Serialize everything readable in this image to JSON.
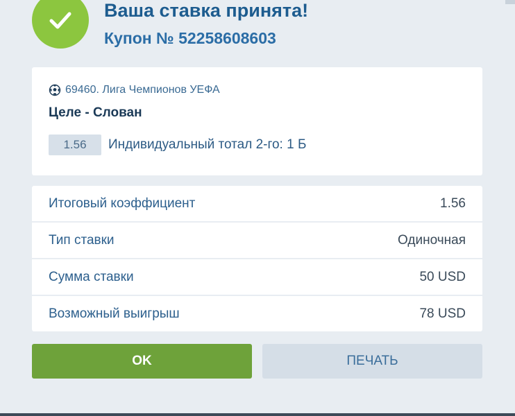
{
  "header": {
    "title": "Ваша ставка принята!",
    "coupon": "Купон № 52258608603"
  },
  "event": {
    "league_icon": "soccer-ball-icon",
    "league": "69460. Лига Чемпионов УЕФА",
    "match": "Целе - Слован",
    "odds": "1.56",
    "bet": "Индивидуальный тотал 2-го: 1 Б"
  },
  "summary": {
    "rows": [
      {
        "label": "Итоговый коэффициент",
        "value": "1.56"
      },
      {
        "label": "Тип ставки",
        "value": "Одиночная"
      },
      {
        "label": "Сумма ставки",
        "value": "50 USD"
      },
      {
        "label": "Возможный выигрыш",
        "value": "78 USD"
      }
    ]
  },
  "buttons": {
    "ok": "OK",
    "print": "ПЕЧАТЬ"
  },
  "colors": {
    "success": "#8cc63f",
    "ok_button": "#6ea23a",
    "title": "#1d5c8f",
    "background": "#e8edf2"
  }
}
